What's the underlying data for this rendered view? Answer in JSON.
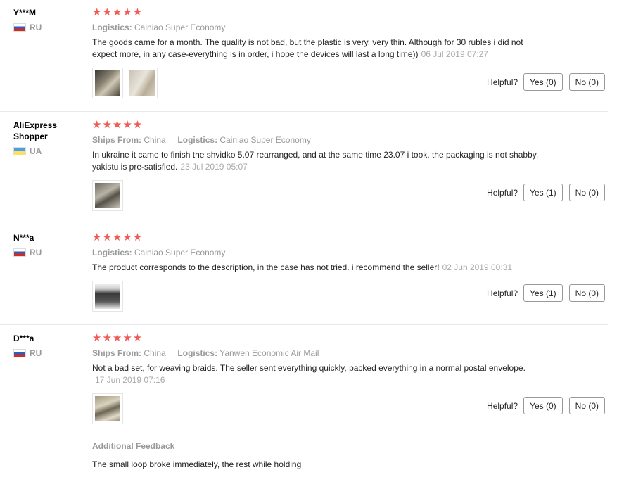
{
  "reviews": [
    {
      "user": "Y***M",
      "country": "RU",
      "stars": "★★★★★",
      "ships_from_label": "",
      "ships_from": "",
      "logistics_label": "Logistics:",
      "logistics": "Cainiao Super Economy",
      "text": "The goods came for a month. The quality is not bad, but the plastic is very, very thin. Although for 30 rubles i did not expect more, in any case-everything is in order, i hope the devices will last a long time))",
      "date": "06 Jul 2019 07:27",
      "helpful_label": "Helpful?",
      "yes_label": "Yes (0)",
      "no_label": "No (0)"
    },
    {
      "user": "AliExpress Shopper",
      "country": "UA",
      "stars": "★★★★★",
      "ships_from_label": "Ships From:",
      "ships_from": "China",
      "logistics_label": "Logistics:",
      "logistics": "Cainiao Super Economy",
      "text": "In ukraine it came to finish the shvidko 5.07 rearranged, and at the same time 23.07 i took, the packaging is not shabby, yakistu is pre-satisfied.",
      "date": "23 Jul 2019 05:07",
      "helpful_label": "Helpful?",
      "yes_label": "Yes (1)",
      "no_label": "No (0)"
    },
    {
      "user": "N***a",
      "country": "RU",
      "stars": "★★★★★",
      "ships_from_label": "",
      "ships_from": "",
      "logistics_label": "Logistics:",
      "logistics": "Cainiao Super Economy",
      "text": "The product corresponds to the description, in the case has not tried. i recommend the seller!",
      "date": "02 Jun 2019 00:31",
      "helpful_label": "Helpful?",
      "yes_label": "Yes (1)",
      "no_label": "No (0)"
    },
    {
      "user": "D***a",
      "country": "RU",
      "stars": "★★★★★",
      "ships_from_label": "Ships From:",
      "ships_from": "China",
      "logistics_label": "Logistics:",
      "logistics": "Yanwen Economic Air Mail",
      "text": "Not a bad set, for weaving braids. The seller sent everything quickly, packed everything in a normal postal envelope.",
      "date": "17 Jun 2019 07:16",
      "helpful_label": "Helpful?",
      "yes_label": "Yes (0)",
      "no_label": "No (0)",
      "additional_title": "Additional Feedback",
      "additional_text": "The small loop broke immediately, the rest while holding"
    }
  ],
  "colors": {
    "star": "#f25a53",
    "muted": "#999999",
    "border": "#e8e8e8"
  }
}
